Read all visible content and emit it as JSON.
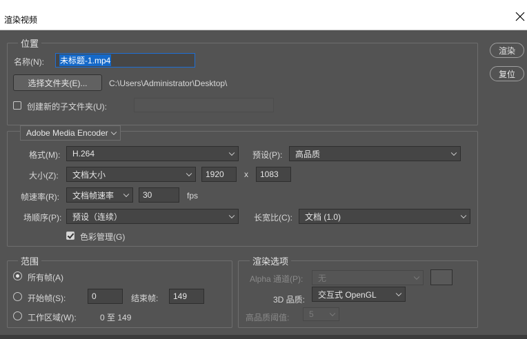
{
  "window": {
    "title": "渲染视频"
  },
  "actions": {
    "render": "渲染",
    "reset": "复位"
  },
  "location": {
    "legend": "位置",
    "name_label": "名称(N):",
    "name_value": "未标题-1.mp4",
    "choose_folder": "选择文件夹(E)...",
    "path": "C:\\Users\\Administrator\\Desktop\\",
    "subfolder_label": "创建新的子文件夹(U):",
    "subfolder_value": "",
    "subfolder_checked": false
  },
  "encoder": {
    "selected": "Adobe Media Encoder",
    "format_label": "格式(M):",
    "format_value": "H.264",
    "preset_label": "预设(P):",
    "preset_value": "高品质",
    "size_label": "大小(Z):",
    "size_value": "文档大小",
    "width": "1920",
    "x": "x",
    "height": "1083",
    "fps_label": "帧速率(R):",
    "fps_mode": "文档帧速率",
    "fps_value": "30",
    "fps_unit": "fps",
    "field_order_label": "场顺序(P):",
    "field_order_value": "预设（连续）",
    "aspect_label": "长宽比(C):",
    "aspect_value": "文档 (1.0)",
    "color_mgmt_label": "色彩管理(G)",
    "color_mgmt_checked": true
  },
  "range": {
    "legend": "范围",
    "all_frames": "所有帧(A)",
    "start_frame_label": "开始帧(S):",
    "start_frame_value": "0",
    "end_frame_label": "结束帧:",
    "end_frame_value": "149",
    "work_area_label": "工作区域(W):",
    "work_area_value": "0 至 149",
    "selected": "all"
  },
  "render_options": {
    "legend": "渲染选项",
    "alpha_label": "Alpha 通道(P):",
    "alpha_value": "无",
    "quality_label": "3D 品质:",
    "quality_value": "交互式 OpenGL",
    "threshold_label": "高品质阈值:",
    "threshold_value": "5"
  }
}
